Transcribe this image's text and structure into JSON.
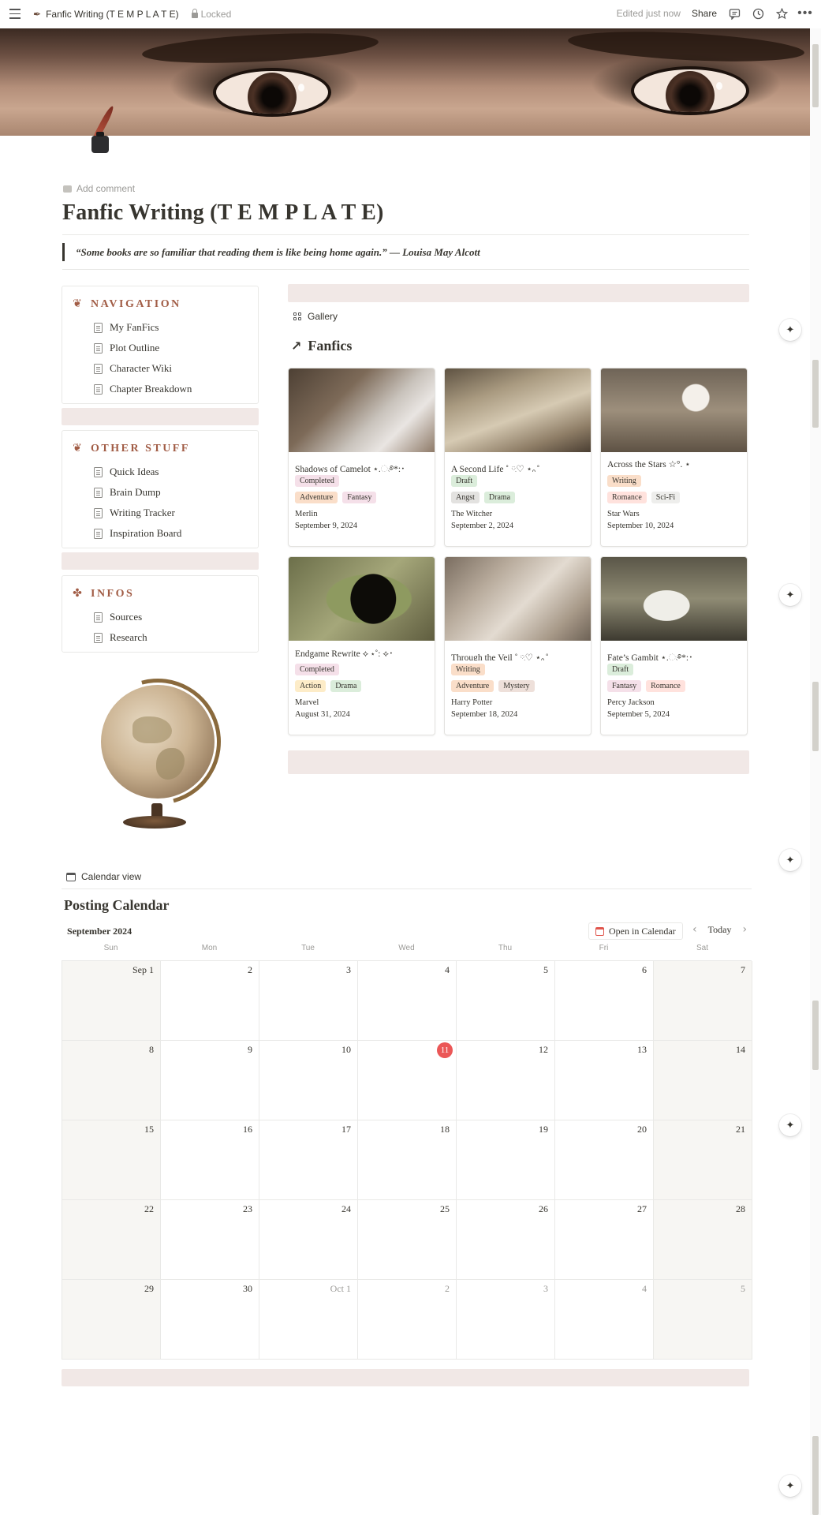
{
  "topbar": {
    "breadcrumb": "Fanfic Writing (T E M P L A T E)",
    "locked": "Locked",
    "edited": "Edited just now",
    "share": "Share"
  },
  "page": {
    "add_comment": "Add comment",
    "title": "Fanfic Writing (T E M P L A T E)",
    "quote": "“Some books are so familiar that reading them is like being home again.” — Louisa May Alcott"
  },
  "navigation": {
    "heading": "NAVIGATION",
    "items": [
      "My FanFics",
      "Plot Outline",
      "Character Wiki",
      "Chapter Breakdown"
    ]
  },
  "other_stuff": {
    "heading": "OTHER STUFF",
    "items": [
      "Quick Ideas",
      "Brain Dump",
      "Writing Tracker",
      "Inspiration Board"
    ]
  },
  "infos": {
    "heading": "INFOS",
    "items": [
      "Sources",
      "Research"
    ]
  },
  "gallery": {
    "view_label": "Gallery",
    "title": "Fanfics",
    "cards": [
      {
        "title": "Shadows of Camelot ⋆.ೃ࿔*:･",
        "status": "Completed",
        "genres": [
          "Adventure",
          "Fantasy"
        ],
        "fandom": "Merlin",
        "date": "September 9, 2024"
      },
      {
        "title": "A Second Life ˚ ༘♡ ⋆｡˚",
        "status": "Draft",
        "genres": [
          "Angst",
          "Drama"
        ],
        "fandom": "The Witcher",
        "date": "September 2, 2024"
      },
      {
        "title": "Across the Stars ☆°. ⋆",
        "status": "Writing",
        "genres": [
          "Romance",
          "Sci-Fi"
        ],
        "fandom": "Star Wars",
        "date": "September 10, 2024"
      },
      {
        "title": "Endgame Rewrite ⟡ ⋆˚: ⟡･",
        "status": "Completed",
        "genres": [
          "Action",
          "Drama"
        ],
        "fandom": "Marvel",
        "date": "August 31, 2024"
      },
      {
        "title": "Through the Veil ˚ ༘♡ ⋆｡˚",
        "status": "Writing",
        "genres": [
          "Adventure",
          "Mystery"
        ],
        "fandom": "Harry Potter",
        "date": "September 18, 2024"
      },
      {
        "title": "Fate’s Gambit ⋆.ೃ࿔*:･",
        "status": "Draft",
        "genres": [
          "Fantasy",
          "Romance"
        ],
        "fandom": "Percy Jackson",
        "date": "September 5, 2024"
      }
    ]
  },
  "calendar": {
    "view_label": "Calendar view",
    "title": "Posting Calendar",
    "month": "September 2024",
    "open_button": "Open in Calendar",
    "today_button": "Today",
    "weekdays": [
      "Sun",
      "Mon",
      "Tue",
      "Wed",
      "Thu",
      "Fri",
      "Sat"
    ],
    "days": [
      "Sep 1",
      "2",
      "3",
      "4",
      "5",
      "6",
      "7",
      "8",
      "9",
      "10",
      "11",
      "12",
      "13",
      "14",
      "15",
      "16",
      "17",
      "18",
      "19",
      "20",
      "21",
      "22",
      "23",
      "24",
      "25",
      "26",
      "27",
      "28",
      "29",
      "30",
      "Oct 1",
      "2",
      "3",
      "4",
      "5"
    ],
    "today_index": 10,
    "muted_from_index": 30
  },
  "colors": {
    "accent": "#a15c45",
    "spacer": "#f1e8e6",
    "today": "#eb5757",
    "status": {
      "Completed": "#f5e0e9",
      "Draft": "#dbeddb",
      "Writing": "#fadec9"
    },
    "genre": {
      "Adventure": "#fadec9",
      "Fantasy": "#f5e0e9",
      "Angst": "#e3e2e0",
      "Drama": "#dbeddb",
      "Romance": "#ffe2dd",
      "Sci-Fi": "#eeeeec",
      "Action": "#fdecc8",
      "Mystery": "#eee0da"
    }
  },
  "icons": {
    "nav_flower": "tulip-icon",
    "other_flower": "tulip-icon",
    "infos_flower": "clover-icon"
  }
}
